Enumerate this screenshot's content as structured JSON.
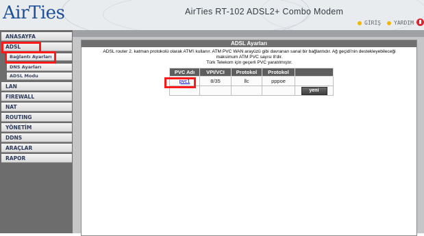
{
  "header": {
    "logo": "AirTies",
    "title": "AirTies RT-102 ADSL2+ Combo Modem",
    "login_label": "GİRİŞ",
    "help_label": "YARDIM",
    "power_icon": "power-icon"
  },
  "sidebar": {
    "items": [
      {
        "label": "ANASAYFA"
      },
      {
        "label": "ADSL"
      },
      {
        "label": "Bağlantı Ayarları"
      },
      {
        "label": "DNS Ayarları"
      },
      {
        "label": "ADSL Modu"
      },
      {
        "label": "LAN"
      },
      {
        "label": "FIREWALL"
      },
      {
        "label": "NAT"
      },
      {
        "label": "ROUTING"
      },
      {
        "label": "YÖNETİM"
      },
      {
        "label": "DDNS"
      },
      {
        "label": "ARAÇLAR"
      },
      {
        "label": "RAPOR"
      }
    ]
  },
  "panel": {
    "title": "ADSL Ayarları",
    "desc_line1": "ADSL router 2. katman protokolü olarak ATM'i kullanır. ATM PVC WAN arayüzü gibi davranan sanal bir bağlantıdır. Ağ geçidi'nin destekleyebileceği",
    "desc_line2": "maksimum ATM PVC sayısı 8'dir.",
    "desc_line3": "Türk Telekom için geçerli PVC yaratılmıştır."
  },
  "pvc_table": {
    "headers": [
      "PVC Adı",
      "VPI/VCI",
      "Protokol",
      "Protokol",
      ""
    ],
    "rows": [
      {
        "name": "pvc1",
        "vpi_vci": "8/35",
        "protocol1": "llc",
        "protocol2": "pppoe"
      }
    ],
    "new_button_label": "yeni"
  },
  "colors": {
    "highlight": "#ff1a1a",
    "brand": "#1d4f9a"
  }
}
